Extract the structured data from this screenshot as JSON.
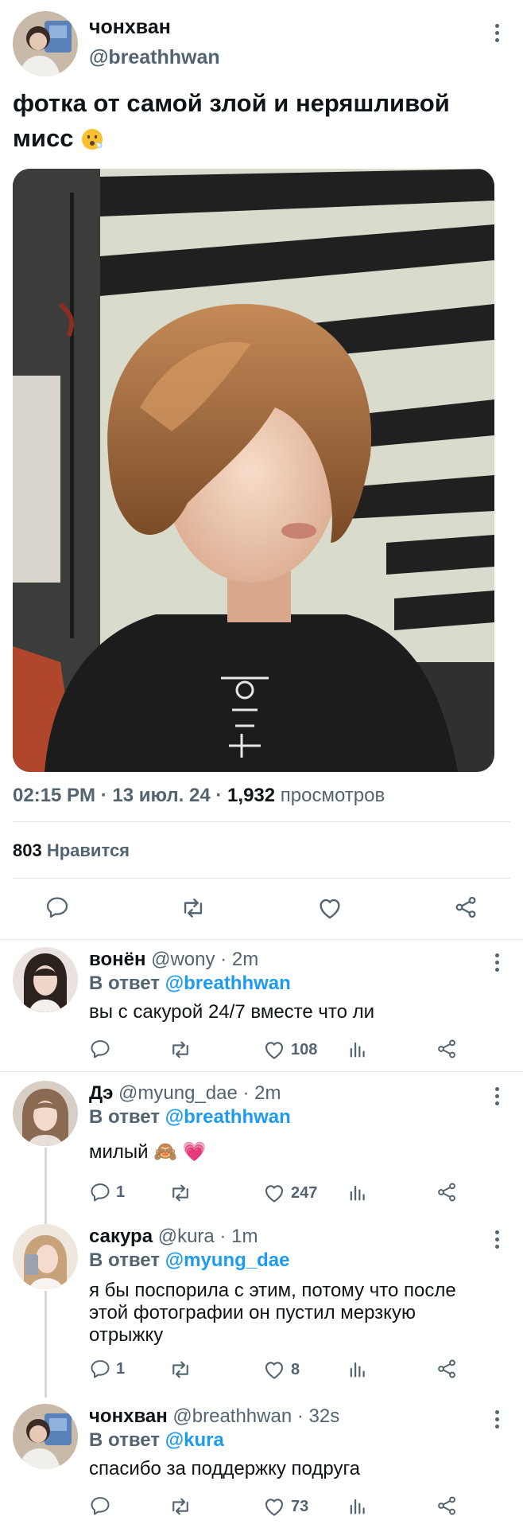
{
  "main_tweet": {
    "author_name": "чонхван",
    "author_handle": "@breathhwan",
    "text": "фотка от самой злой и неряшливой мисс",
    "emoji": "😮‍💨",
    "time": "02:15 PM",
    "date": "13 июл. 24",
    "views_count": "1,932",
    "views_label": "просмотров",
    "likes_count": "803",
    "likes_label": "Нравится",
    "photo_description_icon": "photo"
  },
  "replies": [
    {
      "name": "вонён",
      "handle": "@wony",
      "time": "2m",
      "replying_prefix": "В ответ",
      "replying_to": "@breathhwan",
      "text": "вы с сакурой 24/7 вместе что ли",
      "reply_count": "",
      "like_count": "108"
    },
    {
      "name": "Дэ",
      "handle": "@myung_dae",
      "time": "2m",
      "replying_prefix": "В ответ",
      "replying_to": "@breathhwan",
      "text": "милый",
      "emoji": "🙈 💗",
      "reply_count": "1",
      "like_count": "247"
    },
    {
      "name": "сакура",
      "handle": "@kura",
      "time": "1m",
      "replying_prefix": "В ответ",
      "replying_to": "@myung_dae",
      "text_lines": [
        "я бы поспорила с этим, потому что после",
        "этой фотографии он пустил мерзкую",
        "отрыжку"
      ],
      "reply_count": "1",
      "like_count": "8"
    },
    {
      "name": "чонхван",
      "handle": "@breathhwan",
      "time": "32s",
      "replying_prefix": "В ответ",
      "replying_to": "@kura",
      "text": "спасибо за поддержку подруга",
      "reply_count": "",
      "like_count": "73"
    }
  ],
  "separator": "·",
  "colors": {
    "accent": "#1d9bf0",
    "secondary_text": "#536471",
    "primary_text": "#0f1419"
  }
}
